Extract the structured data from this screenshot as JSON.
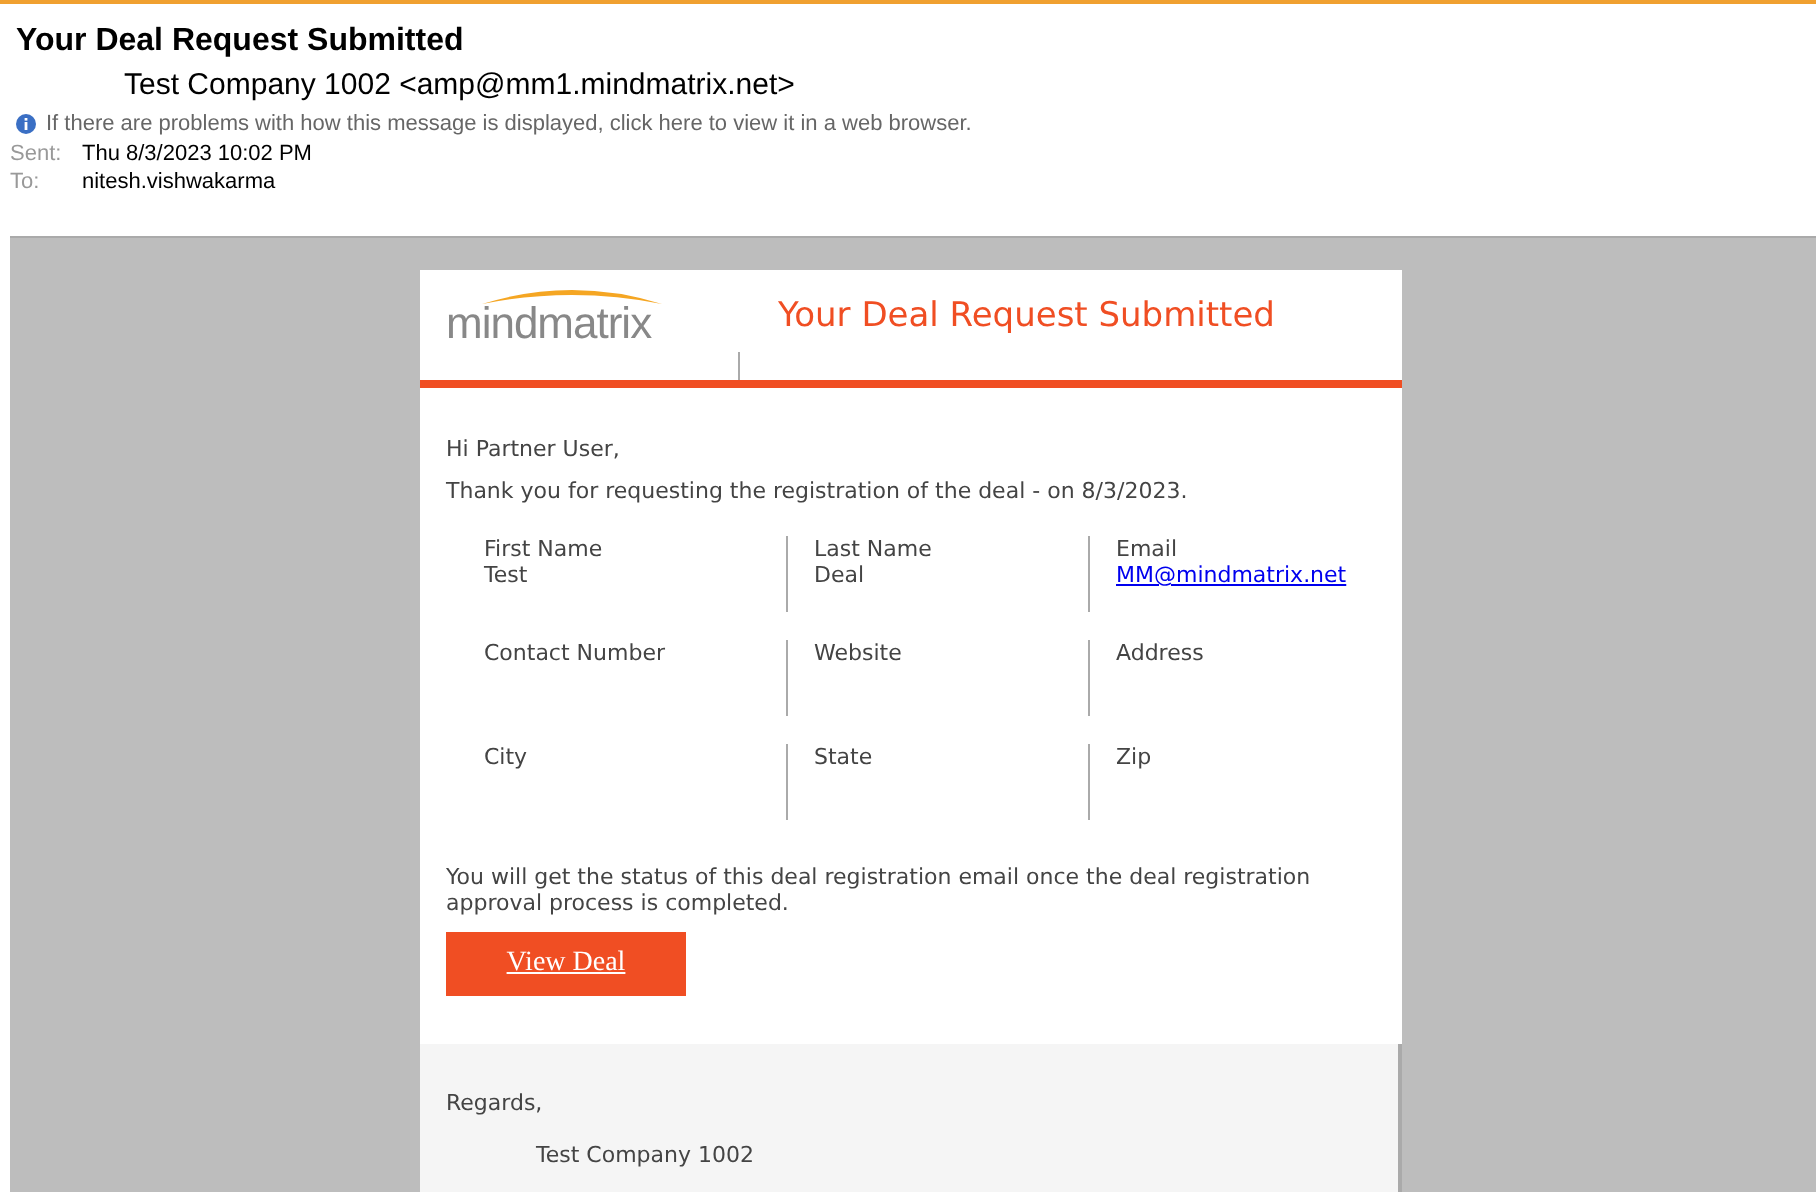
{
  "message": {
    "subject": "Your Deal Request Submitted",
    "from": "Test Company 1002 <amp@mm1.mindmatrix.net>",
    "info_bar": "If there are problems with how this message is displayed, click here to view it in a web browser.",
    "meta": [
      {
        "label": "Sent:",
        "value": "Thu 8/3/2023 10:02 PM"
      },
      {
        "label": "To:",
        "value": "nitesh.vishwakarma"
      }
    ]
  },
  "email": {
    "logo": "mindmatrix",
    "title": "Your Deal Request Submitted",
    "greeting": "Hi Partner User,",
    "intro": "Thank you for requesting the registration of the deal - on 8/3/2023.",
    "fields": [
      {
        "label": "First Name",
        "value": "Test",
        "kind": "text"
      },
      {
        "label": "Last Name",
        "value": "Deal",
        "kind": "text"
      },
      {
        "label": "Email",
        "value": "MM@mindmatrix.net",
        "kind": "link"
      },
      {
        "label": "Contact Number"
      },
      {
        "label": "Website"
      },
      {
        "label": "Address"
      },
      {
        "label": "City"
      },
      {
        "label": "State"
      },
      {
        "label": "Zip"
      }
    ],
    "note": "You will get the status of this deal registration email once the deal registration approval process is completed.",
    "button": "View Deal",
    "regards": "Regards,",
    "signature": "Test Company 1002"
  }
}
